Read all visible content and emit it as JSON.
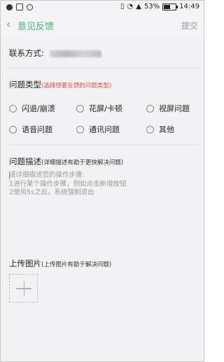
{
  "status_bar": {
    "battery": "53%",
    "time": "14:49"
  },
  "header": {
    "back_icon": "‹",
    "title": "意见反馈",
    "submit_label": "提交"
  },
  "contact": {
    "label": "联系方式:"
  },
  "issue_type": {
    "title": "问题类型",
    "hint": "(选择想要反馈的问题类型)",
    "options": [
      "闪退/崩溃",
      "花屏/卡顿",
      "视屏问题",
      "语音问题",
      "通讯问题",
      "其他"
    ]
  },
  "description": {
    "title": "问题描述",
    "hint": "(详细描述有助于更快解决问题)",
    "placeholder": "请详细描述您的操作步骤:\n1进行某个操作步骤，例如点击新增按钮\n2使用5s之后，系统强制退出"
  },
  "upload": {
    "title": "上传图片",
    "hint": "(上传图片有助于解决问题)"
  },
  "colors": {
    "accent": "#3db67f",
    "hint_red": "#e0504f"
  }
}
